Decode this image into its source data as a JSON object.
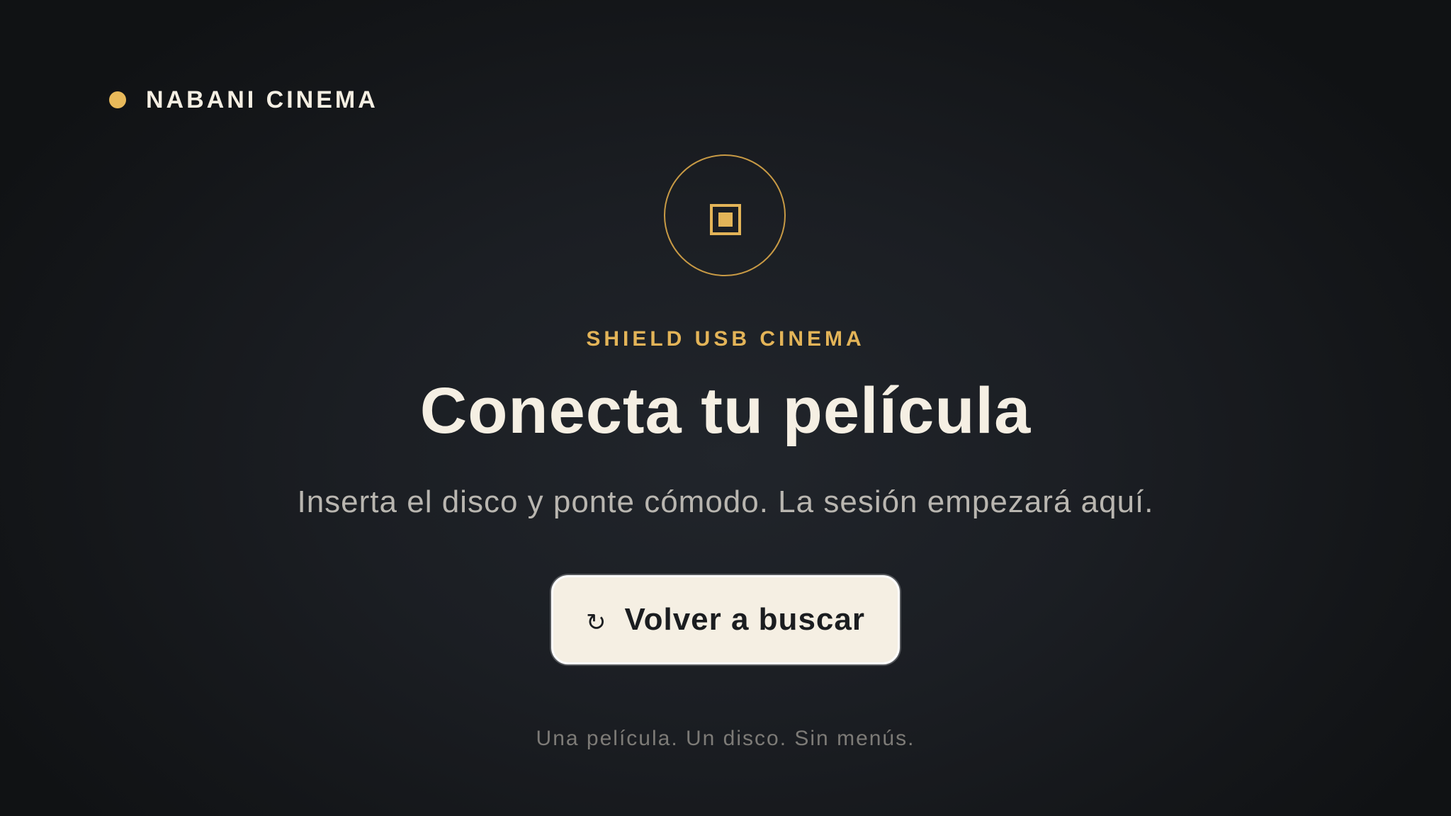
{
  "brand": {
    "name": "NABANI CINEMA",
    "dot_color": "#e8b95a"
  },
  "hero": {
    "icon": "usb-chip-icon",
    "eyebrow": "SHIELD USB CINEMA",
    "title": "Conecta tu película",
    "subtitle": "Inserta el disco y ponte cómodo. La sesión empezará aquí."
  },
  "actions": {
    "retry_icon": "refresh-icon",
    "retry_glyph": "↻",
    "retry_label": "Volver a buscar"
  },
  "footer": {
    "tagline": "Una película. Un disco. Sin menús."
  },
  "colors": {
    "accent": "#e3b458",
    "background": "#1b1e23",
    "text": "#f5efe3",
    "button": "#f5efe3"
  }
}
